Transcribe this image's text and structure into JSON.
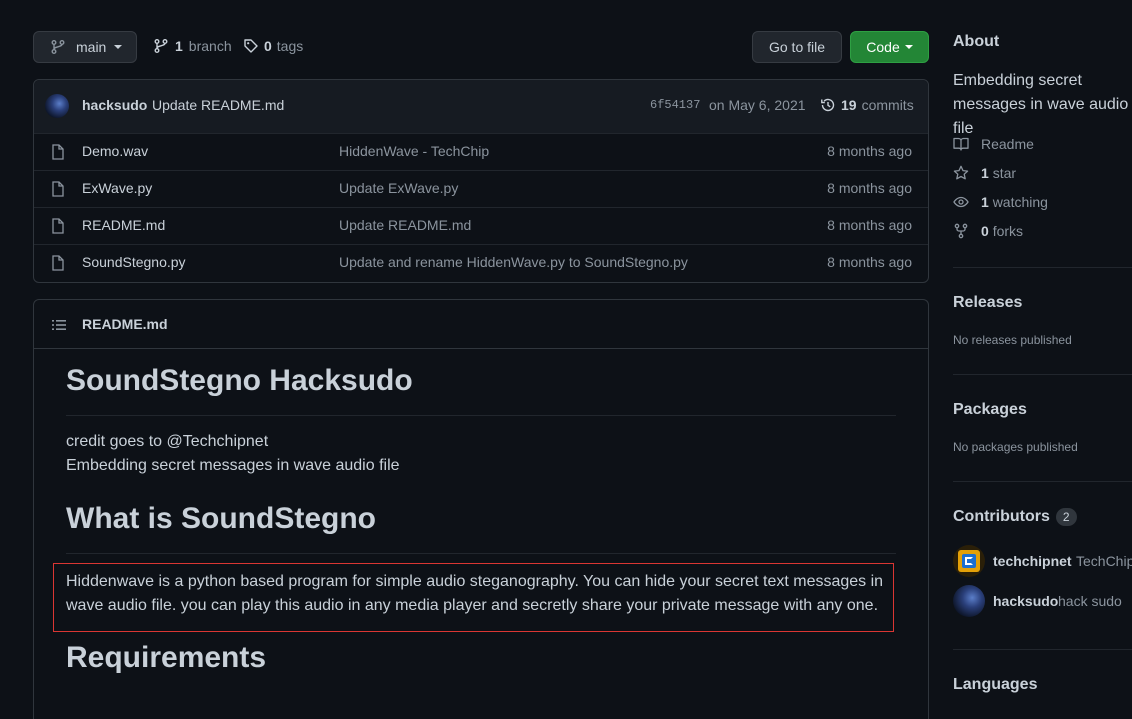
{
  "toolbar": {
    "branch_name": "main",
    "branch_count": "1",
    "branch_label": "branch",
    "tag_count": "0",
    "tag_label": "tags",
    "go_to_file": "Go to file",
    "code": "Code"
  },
  "commit": {
    "author": "hacksudo",
    "message": "Update README.md",
    "hash": "6f54137",
    "date": "on May 6, 2021",
    "count": "19",
    "count_label": "commits"
  },
  "files": [
    {
      "name": "Demo.wav",
      "message": "HiddenWave - TechChip",
      "age": "8 months ago"
    },
    {
      "name": "ExWave.py",
      "message": "Update ExWave.py",
      "age": "8 months ago"
    },
    {
      "name": "README.md",
      "message": "Update README.md",
      "age": "8 months ago"
    },
    {
      "name": "SoundStegno.py",
      "message": "Update and rename HiddenWave.py to SoundStegno.py",
      "age": "8 months ago"
    }
  ],
  "readme": {
    "header": "README.md",
    "h1": "SoundStegno Hacksudo",
    "credit": "credit goes to @Techchipnet",
    "tagline": "Embedding secret messages in wave audio file",
    "h2_what": "What is SoundStegno",
    "description": "Hiddenwave is a python based program for simple audio steganography. You can hide your secret text messages in wave audio file. you can play this audio in any media player and secretly share your private message with any one.",
    "h2_req": "Requirements"
  },
  "about": {
    "heading": "About",
    "description": "Embedding secret messages in wave audio file",
    "readme": "Readme",
    "stars_count": "1",
    "stars_label": "star",
    "watching_count": "1",
    "watching_label": "watching",
    "forks_count": "0",
    "forks_label": "forks"
  },
  "releases": {
    "heading": "Releases",
    "empty": "No releases published"
  },
  "packages": {
    "heading": "Packages",
    "empty": "No packages published"
  },
  "contributors": {
    "heading": "Contributors",
    "count": "2",
    "people": [
      {
        "login": "techchipnet",
        "name": "TechChip"
      },
      {
        "login": "hacksudo",
        "name": "hack sudo"
      }
    ]
  },
  "languages": {
    "heading": "Languages"
  },
  "colors": {
    "bg": "#0d1117",
    "accent_green": "#238636",
    "border": "#30363d",
    "highlight_red": "#da3633"
  }
}
